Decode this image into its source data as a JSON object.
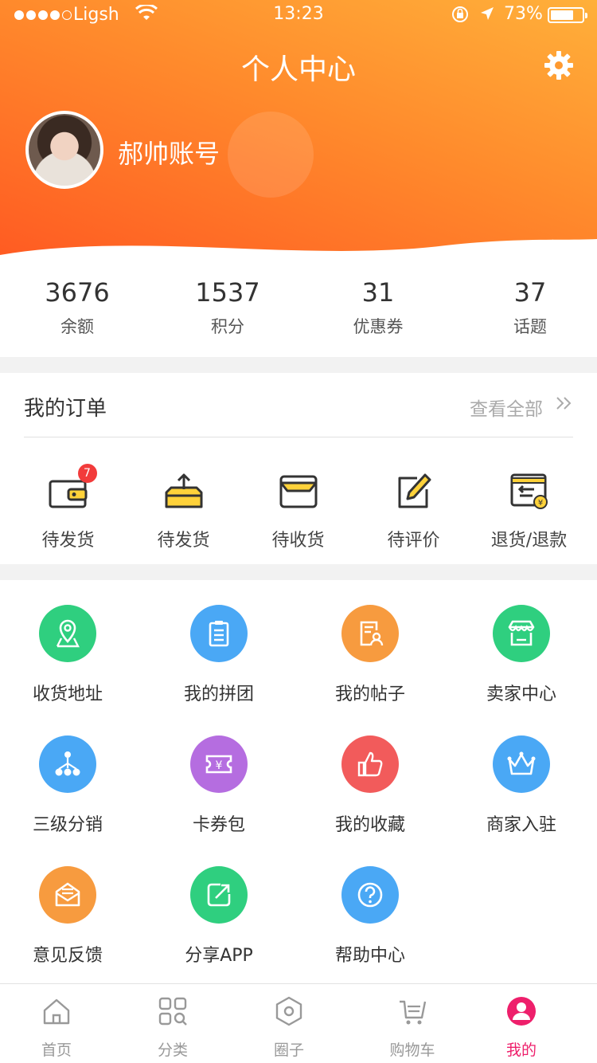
{
  "status_bar": {
    "carrier": "Ligsh",
    "time": "13:23",
    "battery": "73%"
  },
  "header": {
    "title": "个人中心",
    "username": "郝帅账号"
  },
  "stats": [
    {
      "value": "3676",
      "label": "余额"
    },
    {
      "value": "1537",
      "label": "积分"
    },
    {
      "value": "31",
      "label": "优惠券"
    },
    {
      "value": "37",
      "label": "话题"
    }
  ],
  "orders": {
    "title": "我的订单",
    "view_all": "查看全部",
    "items": [
      {
        "label": "待发货",
        "icon": "wallet-icon",
        "badge": "7"
      },
      {
        "label": "待发货",
        "icon": "box-upload-icon"
      },
      {
        "label": "待收货",
        "icon": "inbox-icon"
      },
      {
        "label": "待评价",
        "icon": "edit-icon"
      },
      {
        "label": "退货/退款",
        "icon": "refund-icon"
      }
    ]
  },
  "services": [
    {
      "label": "收货地址",
      "icon": "location-pin-icon",
      "color": "#2fcf7f"
    },
    {
      "label": "我的拼团",
      "icon": "clipboard-icon",
      "color": "#4aa8f5"
    },
    {
      "label": "我的帖子",
      "icon": "post-user-icon",
      "color": "#f79b3f"
    },
    {
      "label": "卖家中心",
      "icon": "store-icon",
      "color": "#2fcf7f"
    },
    {
      "label": "三级分销",
      "icon": "hierarchy-icon",
      "color": "#4aa8f5"
    },
    {
      "label": "卡券包",
      "icon": "coupon-icon",
      "color": "#b56de0"
    },
    {
      "label": "我的收藏",
      "icon": "thumbs-up-icon",
      "color": "#f25b5b"
    },
    {
      "label": "商家入驻",
      "icon": "crown-icon",
      "color": "#4aa8f5"
    },
    {
      "label": "意见反馈",
      "icon": "feedback-mail-icon",
      "color": "#f79b3f"
    },
    {
      "label": "分享APP",
      "icon": "share-icon",
      "color": "#2fcf7f"
    },
    {
      "label": "帮助中心",
      "icon": "help-icon",
      "color": "#4aa8f5"
    }
  ],
  "tabbar": [
    {
      "label": "首页",
      "icon": "home-icon",
      "active": false
    },
    {
      "label": "分类",
      "icon": "category-icon",
      "active": false
    },
    {
      "label": "圈子",
      "icon": "hexagon-icon",
      "active": false
    },
    {
      "label": "购物车",
      "icon": "cart-icon",
      "active": false
    },
    {
      "label": "我的",
      "icon": "profile-icon",
      "active": true
    }
  ],
  "colors": {
    "accent": "#ff8a2c",
    "tab_active": "#ee1f6b"
  }
}
